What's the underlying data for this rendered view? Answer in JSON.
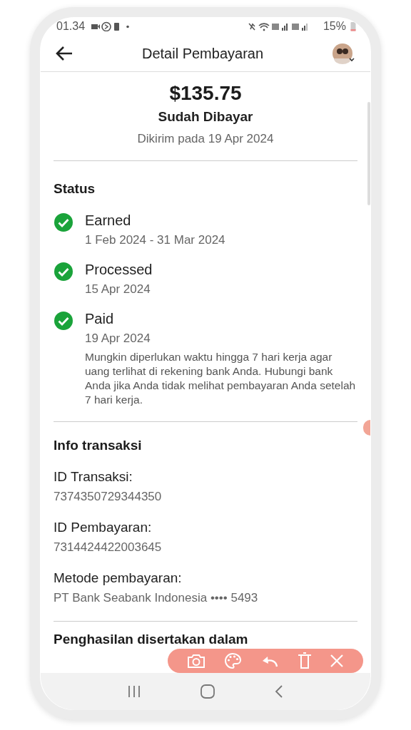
{
  "status_bar": {
    "time": "01.34",
    "battery": "15%"
  },
  "header": {
    "title": "Detail Pembayaran"
  },
  "summary": {
    "amount": "$135.75",
    "status": "Sudah Dibayar",
    "sent": "Dikirim pada 19 Apr 2024"
  },
  "status": {
    "title": "Status",
    "steps": [
      {
        "label": "Earned",
        "date": "1 Feb 2024 - 31 Mar 2024",
        "done": true
      },
      {
        "label": "Processed",
        "date": "15 Apr 2024",
        "done": true
      },
      {
        "label": "Paid",
        "date": "19 Apr 2024",
        "done": true,
        "note": "Mungkin diperlukan waktu hingga 7 hari kerja agar uang terlihat di rekening bank Anda. Hubungi bank Anda jika Anda tidak melihat pembayaran Anda setelah 7 hari kerja."
      }
    ]
  },
  "transaction": {
    "title": "Info transaksi",
    "fields": [
      {
        "label": "ID Transaksi:",
        "value": "7374350729344350"
      },
      {
        "label": "ID Pembayaran:",
        "value": "7314424422003645"
      },
      {
        "label": "Metode pembayaran:",
        "value": "PT Bank Seabank Indonesia •••• 5493"
      }
    ]
  },
  "next_section": {
    "title": "Penghasilan disertakan dalam"
  }
}
